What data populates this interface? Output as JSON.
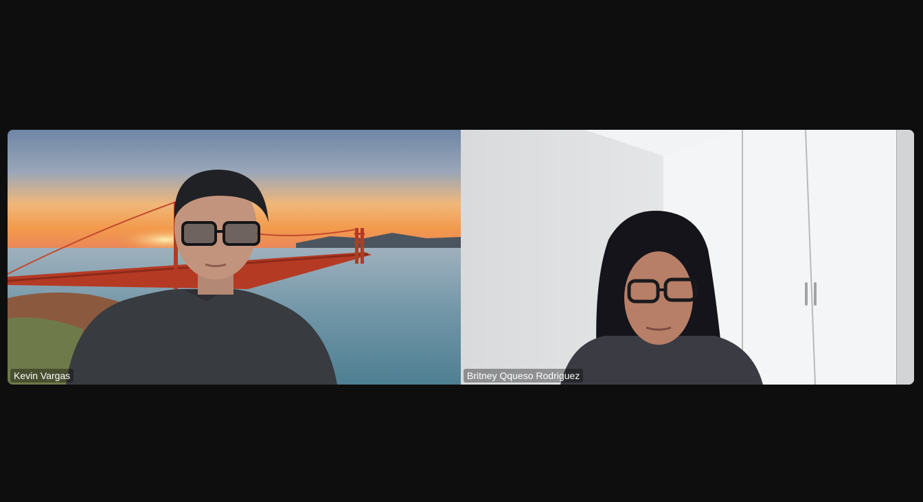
{
  "participants": [
    {
      "name": "Kevin Vargas",
      "background": "golden-gate-bridge-virtual-background"
    },
    {
      "name": "Britney Qqueso Rodriguez",
      "background": "white-room-wardrobe"
    }
  ],
  "colors": {
    "window_background": "#0e0e0f",
    "name_text": "#ffffff"
  }
}
